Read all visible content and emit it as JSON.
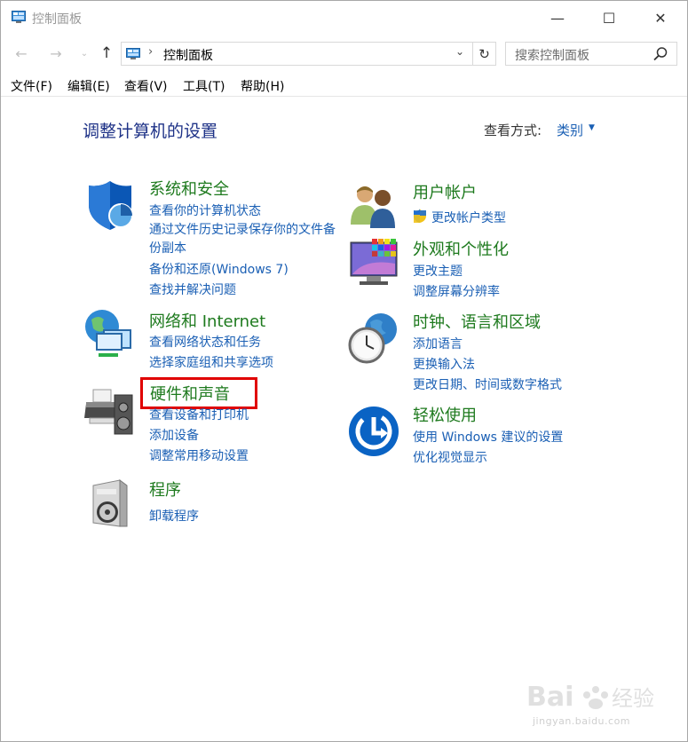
{
  "window": {
    "title": "控制面板",
    "minimize": "—",
    "maximize": "☐",
    "close": "✕"
  },
  "nav": {
    "back": "←",
    "forward": "→",
    "recent": "⌄",
    "up": "↑",
    "breadcrumb_sep": "›",
    "address": "控制面板",
    "dropdown": "⌄",
    "refresh": "↻",
    "search_placeholder": "搜索控制面板"
  },
  "menu": [
    "文件(F)",
    "编辑(E)",
    "查看(V)",
    "工具(T)",
    "帮助(H)"
  ],
  "header": {
    "title": "调整计算机的设置",
    "view_label": "查看方式:",
    "view_value": "类别",
    "caret": "▼"
  },
  "categories": {
    "system": {
      "title": "系统和安全",
      "links": [
        "查看你的计算机状态",
        "通过文件历史记录保存你的文件备份副本",
        "备份和还原(Windows 7)",
        "查找并解决问题"
      ]
    },
    "network": {
      "title": "网络和 Internet",
      "links": [
        "查看网络状态和任务",
        "选择家庭组和共享选项"
      ]
    },
    "hardware": {
      "title": "硬件和声音",
      "links": [
        "查看设备和打印机",
        "添加设备",
        "调整常用移动设置"
      ]
    },
    "programs": {
      "title": "程序",
      "links": [
        "卸载程序"
      ]
    },
    "users": {
      "title": "用户帐户",
      "links": [
        "更改帐户类型"
      ]
    },
    "appearance": {
      "title": "外观和个性化",
      "links": [
        "更改主题",
        "调整屏幕分辨率"
      ]
    },
    "clock": {
      "title": "时钟、语言和区域",
      "links": [
        "添加语言",
        "更换输入法",
        "更改日期、时间或数字格式"
      ]
    },
    "ease": {
      "title": "轻松使用",
      "links": [
        "使用 Windows 建议的设置",
        "优化视觉显示"
      ]
    }
  },
  "colors": {
    "category_title": "#1e7a1e",
    "link": "#1a5fb4",
    "page_title": "#1e3287",
    "highlight": "#e00000"
  },
  "watermark": {
    "text": "jingyan.baidu.com"
  }
}
